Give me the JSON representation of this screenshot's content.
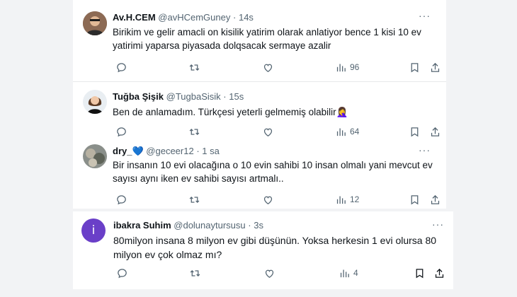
{
  "tweets": [
    {
      "name": "Av.H.CEM",
      "handle": "@avHCemGuney",
      "separator": "·",
      "time": "14s",
      "text_lines": [
        "Birikim ve gelir amacli on kisilik yatirim olarak anlatiyor bence  1 kisi 10 ev",
        "yatirimi yaparsa piyasada dolqsacak sermaye azalir"
      ],
      "views": "96",
      "more": "···"
    },
    {
      "name": "Tuğba Şişik",
      "handle": "@TugbaSisik",
      "separator": "·",
      "time": "15s",
      "text_lines": [
        "Ben de anlamadım. Türkçesi yeterli gelmemiş olabilir🤦‍♀️"
      ],
      "views": "64",
      "more": ""
    },
    {
      "name": "dry_💙",
      "handle": "@geceer12",
      "separator": "·",
      "time": "1 sa",
      "text_lines": [
        "Bir insanın 10 evi olacağına o 10 evin sahibi 10 insan olmalı yani mevcut ev",
        "sayısı aynı iken ev sahibi sayısı artmalı.."
      ],
      "views": "12",
      "more": "···"
    },
    {
      "name": "ibakra Suhim",
      "handle": "@dolunaytursusu",
      "separator": "·",
      "time": "3s",
      "avatar_letter": "i",
      "text_lines": [
        "80milyon insana 8 milyon ev gibi düşünün. Yoksa herkesin 1 evi olursa 80",
        "milyon ev çok olmaz mı?"
      ],
      "views": "4",
      "more": "···"
    }
  ],
  "icons": {
    "reply": "reply-icon",
    "retweet": "retweet-icon",
    "like": "like-icon",
    "views": "views-icon",
    "bookmark": "bookmark-icon",
    "share": "share-icon"
  },
  "colors": {
    "text": "#0f1419",
    "secondary": "#536471",
    "avatar_purple": "#6a3fc8"
  }
}
